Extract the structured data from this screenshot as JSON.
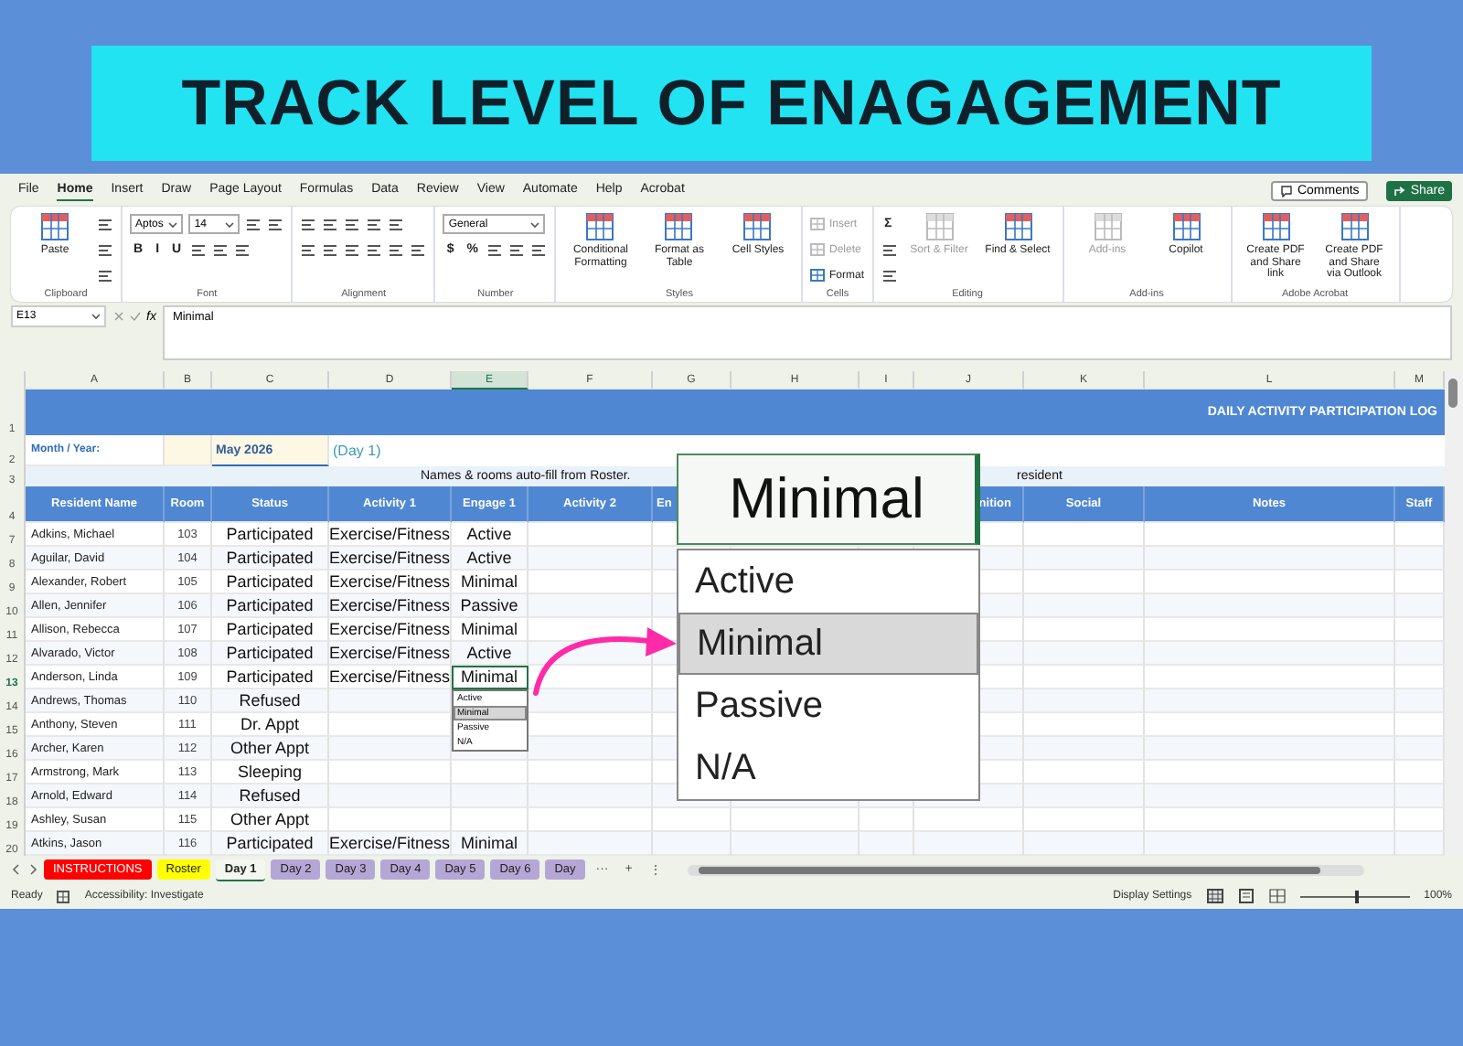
{
  "banner": {
    "title": "TRACK LEVEL OF ENAGAGEMENT"
  },
  "menu_tabs": [
    {
      "label": "File",
      "selected": false
    },
    {
      "label": "Home",
      "selected": true
    },
    {
      "label": "Insert",
      "selected": false
    },
    {
      "label": "Draw",
      "selected": false
    },
    {
      "label": "Page Layout",
      "selected": false
    },
    {
      "label": "Formulas",
      "selected": false
    },
    {
      "label": "Data",
      "selected": false
    },
    {
      "label": "Review",
      "selected": false
    },
    {
      "label": "View",
      "selected": false
    },
    {
      "label": "Automate",
      "selected": false
    },
    {
      "label": "Help",
      "selected": false
    },
    {
      "label": "Acrobat",
      "selected": false
    }
  ],
  "top_buttons": {
    "comments": "Comments",
    "share": "Share"
  },
  "ribbon": {
    "groups": [
      {
        "title": "Clipboard",
        "large": [
          {
            "label": "Paste",
            "disabled": false
          }
        ],
        "stacks_after": [
          {
            "items": [
              {
                "kind": "tool"
              }
            ]
          },
          {
            "items": [
              {
                "kind": "tool"
              }
            ]
          },
          {
            "items": [
              {
                "kind": "tool"
              }
            ]
          }
        ]
      },
      {
        "title": "Font",
        "stacks": [
          {
            "items": [
              {
                "kind": "field",
                "label": "Aptos"
              },
              {
                "kind": "field",
                "label": "14"
              },
              {
                "kind": "tool"
              },
              {
                "kind": "tool"
              }
            ]
          },
          {
            "items": [
              {
                "kind": "glyph",
                "label": "B"
              },
              {
                "kind": "glyph",
                "label": "I"
              },
              {
                "kind": "glyph",
                "label": "U"
              },
              {
                "kind": "tool"
              },
              {
                "kind": "tool"
              },
              {
                "kind": "tool"
              }
            ]
          }
        ]
      },
      {
        "title": "Alignment",
        "stacks": [
          {
            "items": [
              {
                "kind": "tool"
              },
              {
                "kind": "tool"
              },
              {
                "kind": "tool"
              },
              {
                "kind": "tool"
              },
              {
                "kind": "tool"
              }
            ]
          },
          {
            "items": [
              {
                "kind": "tool"
              },
              {
                "kind": "tool"
              },
              {
                "kind": "tool"
              },
              {
                "kind": "tool"
              },
              {
                "kind": "tool"
              },
              {
                "kind": "tool"
              }
            ]
          }
        ]
      },
      {
        "title": "Number",
        "stacks": [
          {
            "items": [
              {
                "kind": "field",
                "label": "General"
              }
            ]
          },
          {
            "items": [
              {
                "kind": "glyph",
                "label": "$"
              },
              {
                "kind": "glyph",
                "label": "%"
              },
              {
                "kind": "tool"
              },
              {
                "kind": "tool"
              },
              {
                "kind": "tool"
              }
            ]
          }
        ]
      },
      {
        "title": "Styles",
        "large": [
          {
            "label": "Conditional Formatting",
            "disabled": false
          },
          {
            "label": "Format as Table",
            "disabled": false
          },
          {
            "label": "Cell Styles",
            "disabled": false
          }
        ]
      },
      {
        "title": "Cells",
        "stacks": [
          {
            "items": [
              {
                "kind": "small",
                "label": "Insert",
                "disabled": true
              }
            ]
          },
          {
            "items": [
              {
                "kind": "small",
                "label": "Delete",
                "disabled": true
              }
            ]
          },
          {
            "items": [
              {
                "kind": "small",
                "label": "Format",
                "disabled": false
              }
            ]
          }
        ]
      },
      {
        "title": "Editing",
        "stacks": [
          {
            "items": [
              {
                "kind": "glyph",
                "label": "Σ"
              }
            ]
          },
          {
            "items": [
              {
                "kind": "tool"
              }
            ]
          },
          {
            "items": [
              {
                "kind": "tool"
              }
            ]
          }
        ],
        "large": [
          {
            "label": "Sort & Filter",
            "disabled": true
          },
          {
            "label": "Find & Select",
            "disabled": false
          }
        ]
      },
      {
        "title": "Add-ins",
        "large": [
          {
            "label": "Add-ins",
            "disabled": true
          },
          {
            "label": "Copilot",
            "disabled": false
          }
        ]
      },
      {
        "title": "Adobe Acrobat",
        "large": [
          {
            "label": "Create PDF and Share link",
            "disabled": false
          },
          {
            "label": "Create PDF and Share via Outlook",
            "disabled": false
          }
        ]
      }
    ]
  },
  "formula_bar": {
    "name_box": "E13",
    "function_label": "fx",
    "formula": "Minimal"
  },
  "columns": [
    {
      "label": "A",
      "selected": false
    },
    {
      "label": "B",
      "selected": false
    },
    {
      "label": "C",
      "selected": false
    },
    {
      "label": "D",
      "selected": false
    },
    {
      "label": "E",
      "selected": true
    },
    {
      "label": "F",
      "selected": false
    },
    {
      "label": "G",
      "selected": false
    },
    {
      "label": "H",
      "selected": false
    },
    {
      "label": "I",
      "selected": false
    },
    {
      "label": "J",
      "selected": false
    },
    {
      "label": "K",
      "selected": false
    },
    {
      "label": "L",
      "selected": false
    },
    {
      "label": "M",
      "selected": false
    }
  ],
  "title_row": {
    "row": "1",
    "text": "DAILY ACTIVITY PARTICIPATION LOG"
  },
  "month_row": {
    "row": "2",
    "label": "Month / Year:",
    "value": "May 2026",
    "day": "(Day 1)"
  },
  "note_row": {
    "row": "3",
    "left": "Names & rooms auto-fill from Roster.",
    "right": "resident"
  },
  "header_row": {
    "row": "4",
    "cells_left": [
      "Resident Name",
      "Room",
      "Status",
      "Activity 1",
      "Engage 1",
      "Activity 2",
      "En"
    ],
    "cells_right": [
      "nition",
      "Social",
      "Notes",
      "Staff"
    ]
  },
  "rows": [
    {
      "row": "7",
      "name": "Adkins, Michael",
      "room": "103",
      "status": "Participated",
      "activity_1": "Exercise/Fitness",
      "engage_1": "Active",
      "selected": false
    },
    {
      "row": "8",
      "name": "Aguilar, David",
      "room": "104",
      "status": "Participated",
      "activity_1": "Exercise/Fitness",
      "engage_1": "Active",
      "selected": false
    },
    {
      "row": "9",
      "name": "Alexander, Robert",
      "room": "105",
      "status": "Participated",
      "activity_1": "Exercise/Fitness",
      "engage_1": "Minimal",
      "selected": false
    },
    {
      "row": "10",
      "name": "Allen, Jennifer",
      "room": "106",
      "status": "Participated",
      "activity_1": "Exercise/Fitness",
      "engage_1": "Passive",
      "selected": false
    },
    {
      "row": "11",
      "name": "Allison, Rebecca",
      "room": "107",
      "status": "Participated",
      "activity_1": "Exercise/Fitness",
      "engage_1": "Minimal",
      "selected": false
    },
    {
      "row": "12",
      "name": "Alvarado, Victor",
      "room": "108",
      "status": "Participated",
      "activity_1": "Exercise/Fitness",
      "engage_1": "Active",
      "selected": false
    },
    {
      "row": "13",
      "name": "Anderson, Linda",
      "room": "109",
      "status": "Participated",
      "activity_1": "Exercise/Fitness",
      "engage_1": "Minimal",
      "selected": true
    },
    {
      "row": "14",
      "name": "Andrews, Thomas",
      "room": "110",
      "status": "Refused",
      "selected": false
    },
    {
      "row": "15",
      "name": "Anthony, Steven",
      "room": "111",
      "status": "Dr. Appt",
      "selected": false
    },
    {
      "row": "16",
      "name": "Archer, Karen",
      "room": "112",
      "status": "Other Appt",
      "selected": false
    },
    {
      "row": "17",
      "name": "Armstrong, Mark",
      "room": "113",
      "status": "Sleeping",
      "selected": false
    },
    {
      "row": "18",
      "name": "Arnold, Edward",
      "room": "114",
      "status": "Refused",
      "selected": false
    },
    {
      "row": "19",
      "name": "Ashley, Susan",
      "room": "115",
      "status": "Other Appt",
      "selected": false
    },
    {
      "row": "20",
      "name": "Atkins, Jason",
      "room": "116",
      "status": "Participated",
      "activity_1": "Exercise/Fitness",
      "engage_1": "Minimal",
      "selected": false
    }
  ],
  "cell_dropdown": {
    "options": [
      {
        "label": "Active",
        "selected": false
      },
      {
        "label": "Minimal",
        "selected": true
      },
      {
        "label": "Passive",
        "selected": false
      },
      {
        "label": "N/A",
        "selected": false
      }
    ]
  },
  "callout": {
    "value": "Minimal",
    "options": [
      {
        "label": "Active",
        "selected": false
      },
      {
        "label": "Minimal",
        "selected": true
      },
      {
        "label": "Passive",
        "selected": false
      },
      {
        "label": "N/A",
        "selected": false
      }
    ]
  },
  "sheet_tabs": [
    {
      "label": "INSTRUCTIONS",
      "selected": false,
      "color": "#ff0000"
    },
    {
      "label": "Roster",
      "selected": false,
      "color": "#ffff00"
    },
    {
      "label": "Day 1",
      "selected": true,
      "color": "#f4f6f0"
    },
    {
      "label": "Day 2",
      "selected": false,
      "color": "#b4a7d6"
    },
    {
      "label": "Day 3",
      "selected": false,
      "color": "#b4a7d6"
    },
    {
      "label": "Day 4",
      "selected": false,
      "color": "#b4a7d6"
    },
    {
      "label": "Day 5",
      "selected": false,
      "color": "#b4a7d6"
    },
    {
      "label": "Day 6",
      "selected": false,
      "color": "#b4a7d6"
    },
    {
      "label": "Day",
      "selected": false,
      "color": "#b4a7d6"
    }
  ],
  "sheet_controls": [
    "···",
    "+",
    "⋮"
  ],
  "status_bar": {
    "ready": "Ready",
    "accessibility": "Accessibility: Investigate",
    "display": "Display Settings",
    "zoom": {
      "level": 0.5,
      "reading": "100%"
    }
  }
}
